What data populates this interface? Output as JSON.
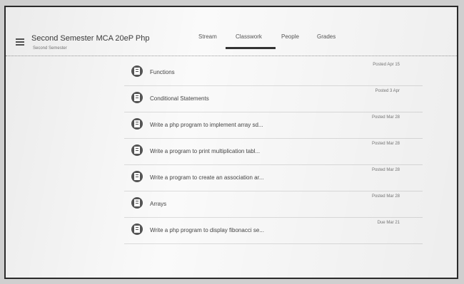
{
  "header": {
    "class_title": "Second Semester MCA 20eP Php",
    "class_subtitle": "Second Semester",
    "tabs": [
      {
        "label": "Stream"
      },
      {
        "label": "Classwork"
      },
      {
        "label": "People"
      },
      {
        "label": "Grades"
      }
    ],
    "active_tab_index": 1
  },
  "classwork": {
    "items": [
      {
        "title": "Functions",
        "date": "Posted Apr 15"
      },
      {
        "title": "Conditional Statements",
        "date": "Posted 3 Apr"
      },
      {
        "title": "Write a php program to implement array sd...",
        "date": "Posted Mar 28"
      },
      {
        "title": "Write a program to print multiplication tabl...",
        "date": "Posted Mar 28"
      },
      {
        "title": "Write a program to create an association ar...",
        "date": "Posted Mar 28"
      },
      {
        "title": "Arrays",
        "date": "Posted Mar 28"
      },
      {
        "title": "Write a php program to display fibonacci se...",
        "date": "Due Mar 21"
      }
    ]
  },
  "colors": {
    "text_primary": "#444444",
    "icon_bg": "#555555",
    "active_indicator": "#333333"
  }
}
